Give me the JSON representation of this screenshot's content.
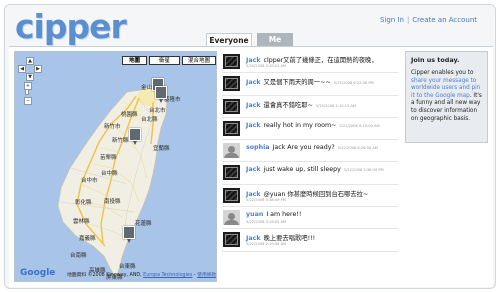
{
  "app": {
    "logo": "cipper"
  },
  "header": {
    "sign_in": "Sign In",
    "separator": "|",
    "create_account": "Create an Account"
  },
  "tabs": [
    {
      "label": "Everyone",
      "active": true
    },
    {
      "label": "Me",
      "active": false
    }
  ],
  "map": {
    "map_types": [
      "地圖",
      "衛星",
      "混合地圖"
    ],
    "zoom_in": "+",
    "zoom_out": "−",
    "pan": [
      "▲",
      "◀",
      "▶",
      "▼"
    ],
    "google_mark": "Google",
    "attribution_text": "地圖資料 ©2008 Kingway, AND, ",
    "attribution_link1": "Europa Technologies",
    "attribution_sep": " - ",
    "attribution_link2": "使用條款",
    "places": [
      "金山",
      "基隆市",
      "台北市",
      "台北縣",
      "桃園縣",
      "新竹市",
      "新竹縣",
      "宜蘭縣",
      "苗栗縣",
      "台中縣",
      "台中市",
      "南投縣",
      "彰化縣",
      "雲林縣",
      "嘉義縣",
      "花蓮縣",
      "台南縣",
      "台東縣",
      "高雄縣",
      "屏東縣"
    ]
  },
  "feed": [
    {
      "user": "Jack",
      "text": "clpper又前了幾條正，在這開熱的夜晚，",
      "time": "5/25/2008 5:29:24 AM",
      "avatar": "dark"
    },
    {
      "user": "Jack",
      "text": "又是個下雨天的周一~~",
      "time": "5/25/2008 6:22:48 PM",
      "avatar": "dark",
      "inline_time": true
    },
    {
      "user": "Jack",
      "text": "還會真不錯吃耶~",
      "time": "5/25/2008 1:10:13 AM",
      "avatar": "dark",
      "inline_time": true
    },
    {
      "user": "Jack",
      "text": "really hot in my room~",
      "time": "5/22/2008 6:10:00 AM",
      "avatar": "dark",
      "inline_time": true
    },
    {
      "user": "sophia",
      "text": "Jack Are you ready?",
      "time": "5/22/2008 6:26:58 AM",
      "avatar": "photo",
      "inline_time": true
    },
    {
      "user": "Jack",
      "text": "just wake up, still sleepy",
      "time": "5/22/2008 3:38:49 PM",
      "avatar": "dark",
      "inline_time": true
    },
    {
      "user": "Jack",
      "text": "@yuan 你甚麼時候回到台石哪去拉~",
      "time": "5/22/2008 3:38:49 PM",
      "avatar": "dark",
      "inline_time": true
    },
    {
      "user": "yuan",
      "text": "I am here!!",
      "time": "5/22/2008 3:16:05 AM",
      "avatar": "photo",
      "inline_time": true
    },
    {
      "user": "Jack",
      "text": "晚上要去唱歌吧!!!",
      "time": "5/22/2008 2:19:38 AM",
      "avatar": "dark",
      "inline_time": true
    }
  ],
  "join_panel": {
    "title": "Join us today.",
    "body_a": "Cipper enables you to ",
    "body_link": "share your message to worldwide users and pin it to the Google map",
    "body_b": ". It's a funny and all new way to discover information on geographic basis."
  }
}
